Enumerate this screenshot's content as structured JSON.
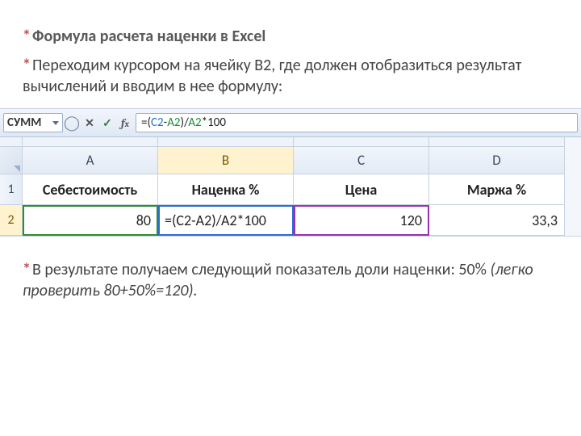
{
  "text": {
    "title": "Формула расчета наценки в Excel",
    "line2": "Переходим курсором на ячейку B2, где должен отобразиться результат вычислений и вводим в нее формулу:",
    "result_a": "В результате получаем следующий показатель доли наценки: 50% ",
    "result_b": "(легко проверить 80+50%=120)."
  },
  "excel": {
    "name_box": "СУММ",
    "formula_plain": "=(C2-A2)/A2*100",
    "columns": [
      "A",
      "B",
      "C",
      "D"
    ],
    "rows": [
      "1",
      "2"
    ],
    "headers": {
      "A": "Себестоимость",
      "B": "Наценка %",
      "C": "Цена",
      "D": "Маржа %"
    },
    "data_row": {
      "A": "80",
      "B": "=(C2-A2)/A2*100",
      "C": "120",
      "D": "33,3"
    }
  },
  "chart_data": {
    "type": "table",
    "columns": [
      "Себестоимость",
      "Наценка %",
      "Цена",
      "Маржа %"
    ],
    "rows": [
      {
        "Себестоимость": 80,
        "Наценка %": "=(C2-A2)/A2*100",
        "Цена": 120,
        "Маржа %": 33.3
      }
    ],
    "title": "Формула расчета наценки в Excel"
  }
}
